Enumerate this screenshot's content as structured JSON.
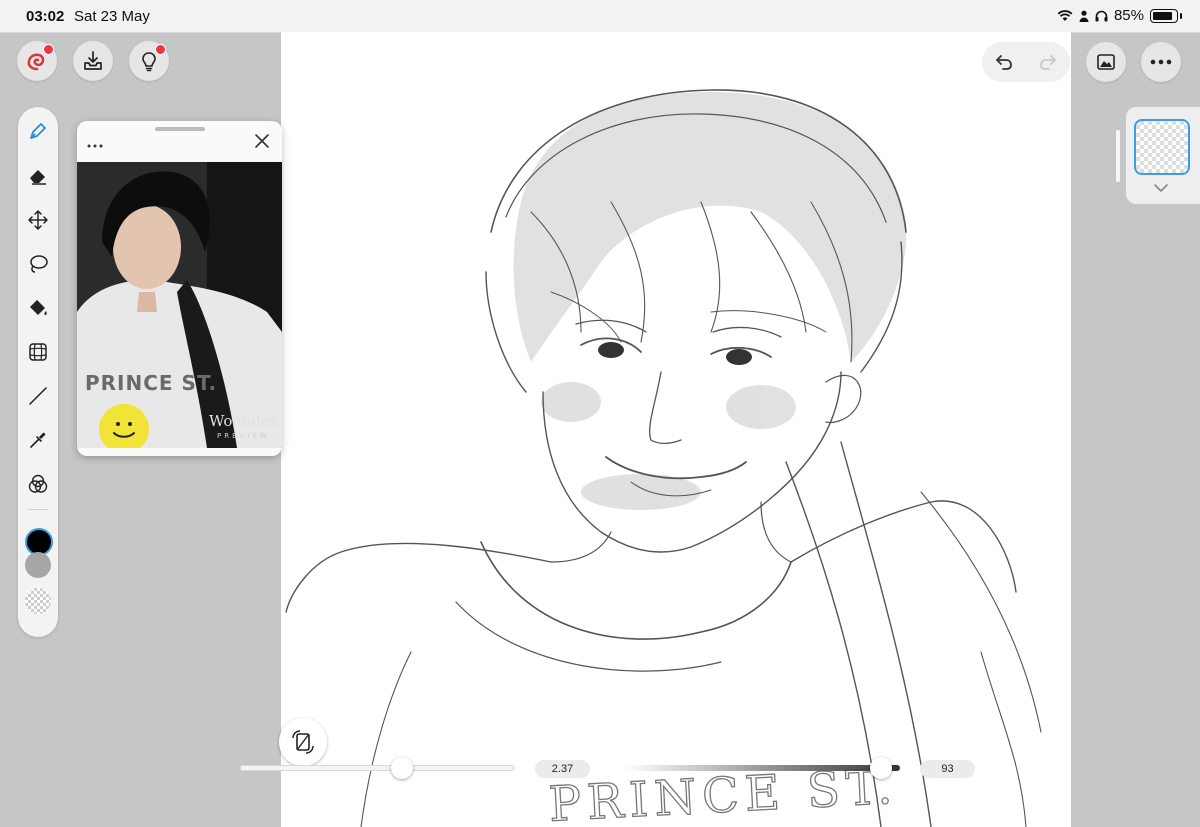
{
  "status_bar": {
    "time": "03:02",
    "date": "Sat 23 May",
    "battery_percent": "85%",
    "battery_level": 0.85
  },
  "top_left_buttons": [
    {
      "name": "brand-menu",
      "icon": "brand-swirl-icon",
      "badge": true
    },
    {
      "name": "export",
      "icon": "download-tray-icon",
      "badge": false
    },
    {
      "name": "tips",
      "icon": "lightbulb-icon",
      "badge": true
    }
  ],
  "top_right": {
    "undo_icon": "undo-arrow-icon",
    "redo_icon": "redo-arrow-icon",
    "redo_enabled": false,
    "gallery_icon": "image-icon",
    "more_icon": "ellipsis-icon"
  },
  "tools": [
    {
      "name": "pen",
      "icon": "pen-nib-icon",
      "active": true
    },
    {
      "name": "eraser",
      "icon": "eraser-icon",
      "active": false
    },
    {
      "name": "move",
      "icon": "move-arrows-icon",
      "active": false
    },
    {
      "name": "lasso",
      "icon": "lasso-icon",
      "active": false
    },
    {
      "name": "fill",
      "icon": "paint-bucket-icon",
      "active": false
    },
    {
      "name": "transform",
      "icon": "grid-warp-icon",
      "active": false
    },
    {
      "name": "line",
      "icon": "line-icon",
      "active": false
    },
    {
      "name": "eyedropper",
      "icon": "eyedropper-icon",
      "active": false
    },
    {
      "name": "blend",
      "icon": "blend-circles-icon",
      "active": false
    }
  ],
  "colors": {
    "primary": "#000000",
    "secondary": "#a6a6a6",
    "accent": "#3a9ee6",
    "badge": "#e8383d"
  },
  "reference_panel": {
    "menu_icon": "ellipsis-icon",
    "close_icon": "close-icon",
    "shirt_text": "PRINCE ST.",
    "watermark": "Woonder.",
    "watermark_sub": "PREVIEW"
  },
  "layers": {
    "expand_icon": "chevron-down-icon"
  },
  "bottom_controls": {
    "flip_icon": "flip-canvas-icon",
    "size_value": "2.37",
    "size_position": 0.59,
    "opacity_value": "93",
    "opacity_position": 0.93
  },
  "canvas": {
    "sketch_text": "PRINCE ST."
  }
}
